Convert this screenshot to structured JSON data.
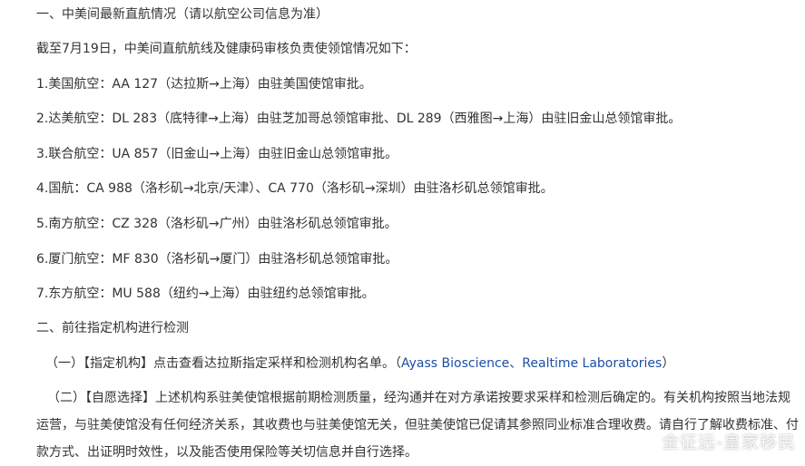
{
  "sections": {
    "s1_heading": "一、中美间最新直航情况（请以航空公司信息为准）",
    "s1_intro": "截至7月19日，中美间直航航线及健康码审核负责使领馆情况如下：",
    "flights": [
      "1.美国航空：AA 127（达拉斯→上海）由驻美国使馆审批。",
      "2.达美航空：DL 283（底特律→上海）由驻芝加哥总领馆审批、DL 289（西雅图→上海）由驻旧金山总领馆审批。",
      "3.联合航空：UA 857（旧金山→上海）由驻旧金山总领馆审批。",
      "4.国航：CA 988（洛杉矶→北京/天津）、CA 770（洛杉矶→深圳）由驻洛杉矶总领馆审批。",
      "5.南方航空：CZ 328（洛杉矶→广州）由驻洛杉矶总领馆审批。",
      "6.厦门航空：MF 830（洛杉矶→厦门）由驻洛杉矶总领馆审批。",
      "7.东方航空：MU 588（纽约→上海）由驻纽约总领馆审批。"
    ],
    "s2_heading": "二、前往指定机构进行检测",
    "s2_item1_prefix": "（一）【指定机构】点击查看达拉斯指定采样和检测机构名单。（",
    "s2_item1_link1": "Ayass Bioscience",
    "s2_item1_sep": "、",
    "s2_item1_link2": "Realtime Laboratories",
    "s2_item1_suffix": "）",
    "s2_item2": "（二）【自愿选择】上述机构系驻美使馆根据前期检测质量，经沟通并在对方承诺按要求采样和检测后确定的。有关机构按照当地法规运营，与驻美使馆没有任何经济关系，其收费也与驻美使馆无关，但驻美使馆已促请其参照同业标准合理收费。请自行了解收费标准、付款方式、出证明时效性，以及能否使用保险等关切信息并自行选择。"
  },
  "watermark": {
    "text": "金征远-皇家移民",
    "icon": "weibo-icon"
  },
  "colors": {
    "text": "#333333",
    "link": "#1b4fa6"
  }
}
